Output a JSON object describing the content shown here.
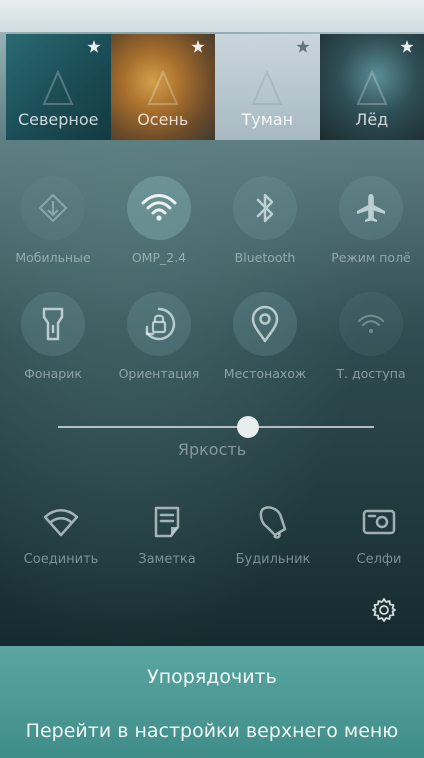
{
  "themes": [
    {
      "label": "Северное",
      "icon": "star-icon"
    },
    {
      "label": "Осень",
      "icon": "star-icon"
    },
    {
      "label": "Туман",
      "icon": "star-icon"
    },
    {
      "label": "Лёд",
      "icon": "star-icon"
    }
  ],
  "toggles_row1": [
    {
      "label": "Мобильные",
      "icon": "mobile-data-icon",
      "state": "faint"
    },
    {
      "label": "OMP_2.4",
      "icon": "wifi-icon",
      "state": "active"
    },
    {
      "label": "Bluetooth",
      "icon": "bluetooth-icon",
      "state": "normal"
    },
    {
      "label": "Режим полё",
      "icon": "airplane-icon",
      "state": "normal"
    }
  ],
  "toggles_row2": [
    {
      "label": "Фонарик",
      "icon": "flashlight-icon",
      "state": "normal"
    },
    {
      "label": "Ориентация",
      "icon": "orientation-lock-icon",
      "state": "normal"
    },
    {
      "label": "Местонахож",
      "icon": "location-pin-icon",
      "state": "normal"
    },
    {
      "label": "Т. доступа",
      "icon": "hotspot-icon",
      "state": "faint"
    }
  ],
  "brightness": {
    "label": "Яркость",
    "value": 0.6
  },
  "shortcuts": [
    {
      "label": "Соединить",
      "icon": "wifi-connect-icon"
    },
    {
      "label": "Заметка",
      "icon": "note-icon"
    },
    {
      "label": "Будильник",
      "icon": "alarm-bell-icon"
    },
    {
      "label": "Селфи",
      "icon": "camera-icon"
    }
  ],
  "footer": {
    "arrange_label": "Упорядочить",
    "settings_label": "Перейти в настройки верхнего меню"
  },
  "colors": {
    "accent": "#4f9c98",
    "active_circle": "#7fb0b2"
  }
}
